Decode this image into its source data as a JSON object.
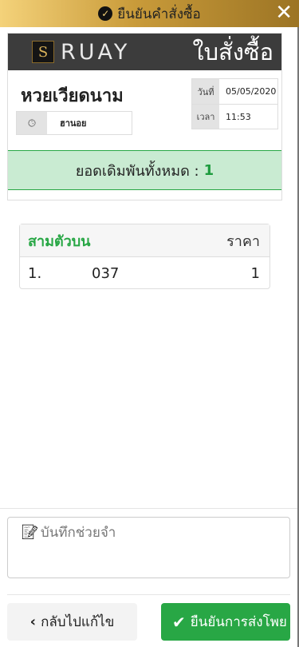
{
  "header": {
    "title": "ยืนยันคำสั่งซื้อ",
    "check_icon": "check-circle-icon",
    "close_icon": "close-icon"
  },
  "receipt": {
    "brand": "RUAY",
    "logo_letter": "S",
    "order_title": "ใบสั่งซื้อ",
    "lotto_name": "หวยเวียดนาม",
    "round_name": "ฮานอย",
    "date_label": "วันที่",
    "date_value": "05/05/2020",
    "time_label": "เวลา",
    "time_value": "11:53",
    "total_label": "ยอดเดิมพันทั้งหมด :",
    "total_value": "1"
  },
  "bets": {
    "type_label": "สามตัวบน",
    "price_header": "ราคา",
    "rows": [
      {
        "index": "1.",
        "number": "037",
        "price": "1"
      }
    ]
  },
  "note": {
    "placeholder": "บันทึกช่วยจำ"
  },
  "actions": {
    "back_label": "กลับไปแก้ไข",
    "confirm_label": "ยืนยันการส่งโพย"
  },
  "colors": {
    "accent_green": "#28a745",
    "header_gold": "#c99b3a",
    "brand_bar": "#3c3c3c"
  }
}
